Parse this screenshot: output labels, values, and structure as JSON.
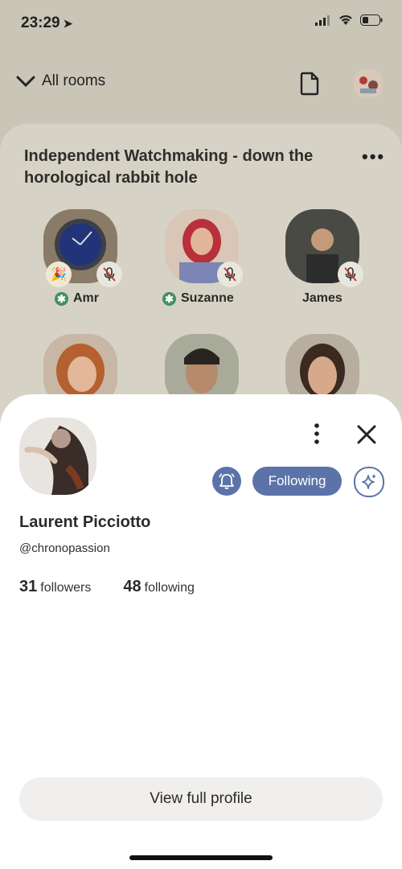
{
  "status_bar": {
    "time": "23:29"
  },
  "nav": {
    "all_rooms_label": "All rooms"
  },
  "room": {
    "title": "Independent Watchmaking - down the horological rabbit hole",
    "more_label": "•••",
    "speakers": [
      {
        "name": "Amr",
        "moderator": true
      },
      {
        "name": "Suzanne",
        "moderator": true
      },
      {
        "name": "James",
        "moderator": false
      }
    ],
    "moderator_symbol": "✱"
  },
  "profile": {
    "name": "Laurent Picciotto",
    "handle": "@chronopassion",
    "followers_count": "31",
    "followers_label": "followers",
    "following_count": "48",
    "following_label": "following",
    "follow_button_label": "Following",
    "view_profile_label": "View full profile"
  },
  "colors": {
    "accent": "#5b73a8",
    "moderator_green": "#3f8f61",
    "dim_background": "#c9c6b8"
  }
}
